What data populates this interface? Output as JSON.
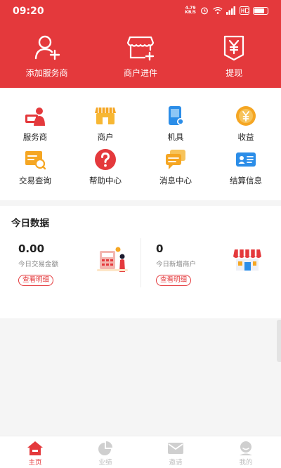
{
  "status_bar": {
    "time": "09:20",
    "speed_value": "4.79",
    "speed_unit": "KB/S",
    "battery_level": 0.85
  },
  "header": {
    "background_color": "#e4393c",
    "actions": [
      {
        "label": "添加服务商",
        "icon": "add-user-icon"
      },
      {
        "label": "商户进件",
        "icon": "store-add-icon"
      },
      {
        "label": "提现",
        "icon": "withdraw-yen-icon"
      }
    ]
  },
  "grid": {
    "items": [
      {
        "label": "服务商",
        "icon": "service-provider-icon"
      },
      {
        "label": "商户",
        "icon": "merchant-store-icon"
      },
      {
        "label": "机具",
        "icon": "pos-device-icon"
      },
      {
        "label": "收益",
        "icon": "earnings-coin-icon"
      },
      {
        "label": "交易查询",
        "icon": "transaction-search-icon"
      },
      {
        "label": "帮助中心",
        "icon": "help-question-icon"
      },
      {
        "label": "消息中心",
        "icon": "message-chat-icon"
      },
      {
        "label": "结算信息",
        "icon": "settlement-card-icon"
      }
    ]
  },
  "today": {
    "title": "今日数据",
    "stats": [
      {
        "value": "0.00",
        "label": "今日交易金额",
        "link": "查看明细"
      },
      {
        "value": "0",
        "label": "今日新增商户",
        "link": "查看明细"
      }
    ]
  },
  "bottom_nav": {
    "accent_color": "#e4393c",
    "items": [
      {
        "label": "主页",
        "icon": "home-icon",
        "active": true
      },
      {
        "label": "业绩",
        "icon": "pie-chart-icon",
        "active": false
      },
      {
        "label": "邀请",
        "icon": "mail-icon",
        "active": false
      },
      {
        "label": "我的",
        "icon": "profile-icon",
        "active": false
      }
    ]
  }
}
